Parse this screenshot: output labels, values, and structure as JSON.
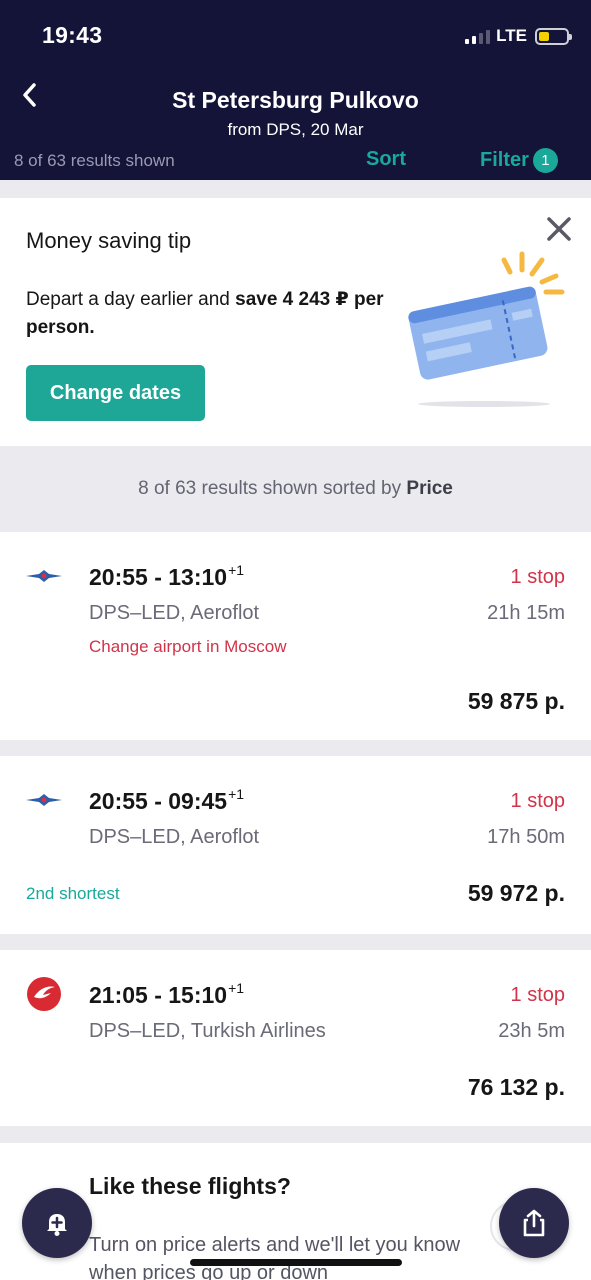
{
  "status_bar": {
    "time": "19:43",
    "network": "LTE"
  },
  "header": {
    "title": "St Petersburg Pulkovo",
    "subtitle": "from DPS, 20 Mar",
    "results_count": "8 of 63 results shown",
    "sort_label": "Sort",
    "filter_label": "Filter",
    "filter_count": "1"
  },
  "tip": {
    "title": "Money saving tip",
    "text_prefix": "Depart a day earlier and ",
    "text_bold": "save 4 243 ₽ per person.",
    "button_label": "Change dates"
  },
  "summary": {
    "prefix": "8 of 63 results shown sorted by ",
    "sort_key": "Price"
  },
  "flights": [
    {
      "airline_icon": "aeroflot-logo",
      "time_range": "20:55 - 13:10",
      "day_offset": "+1",
      "route": "DPS–LED, Aeroflot",
      "stops": "1 stop",
      "duration": "21h 15m",
      "warning": "Change airport in Moscow",
      "tag": "",
      "price": "59 875 р."
    },
    {
      "airline_icon": "aeroflot-logo",
      "time_range": "20:55 - 09:45",
      "day_offset": "+1",
      "route": "DPS–LED, Aeroflot",
      "stops": "1 stop",
      "duration": "17h 50m",
      "warning": "",
      "tag": "2nd shortest",
      "price": "59 972 р."
    },
    {
      "airline_icon": "turkish-airlines-logo",
      "time_range": "21:05 - 15:10",
      "day_offset": "+1",
      "route": "DPS–LED, Turkish Airlines",
      "stops": "1 stop",
      "duration": "23h 5m",
      "warning": "",
      "tag": "",
      "price": "76 132 р."
    }
  ],
  "alerts": {
    "title": "Like these flights?",
    "text": "Turn on price alerts and we'll let you know when prices go up or down"
  },
  "colors": {
    "header_bg": "#141338",
    "accent": "#19a89a",
    "alert_red": "#d1334a"
  }
}
